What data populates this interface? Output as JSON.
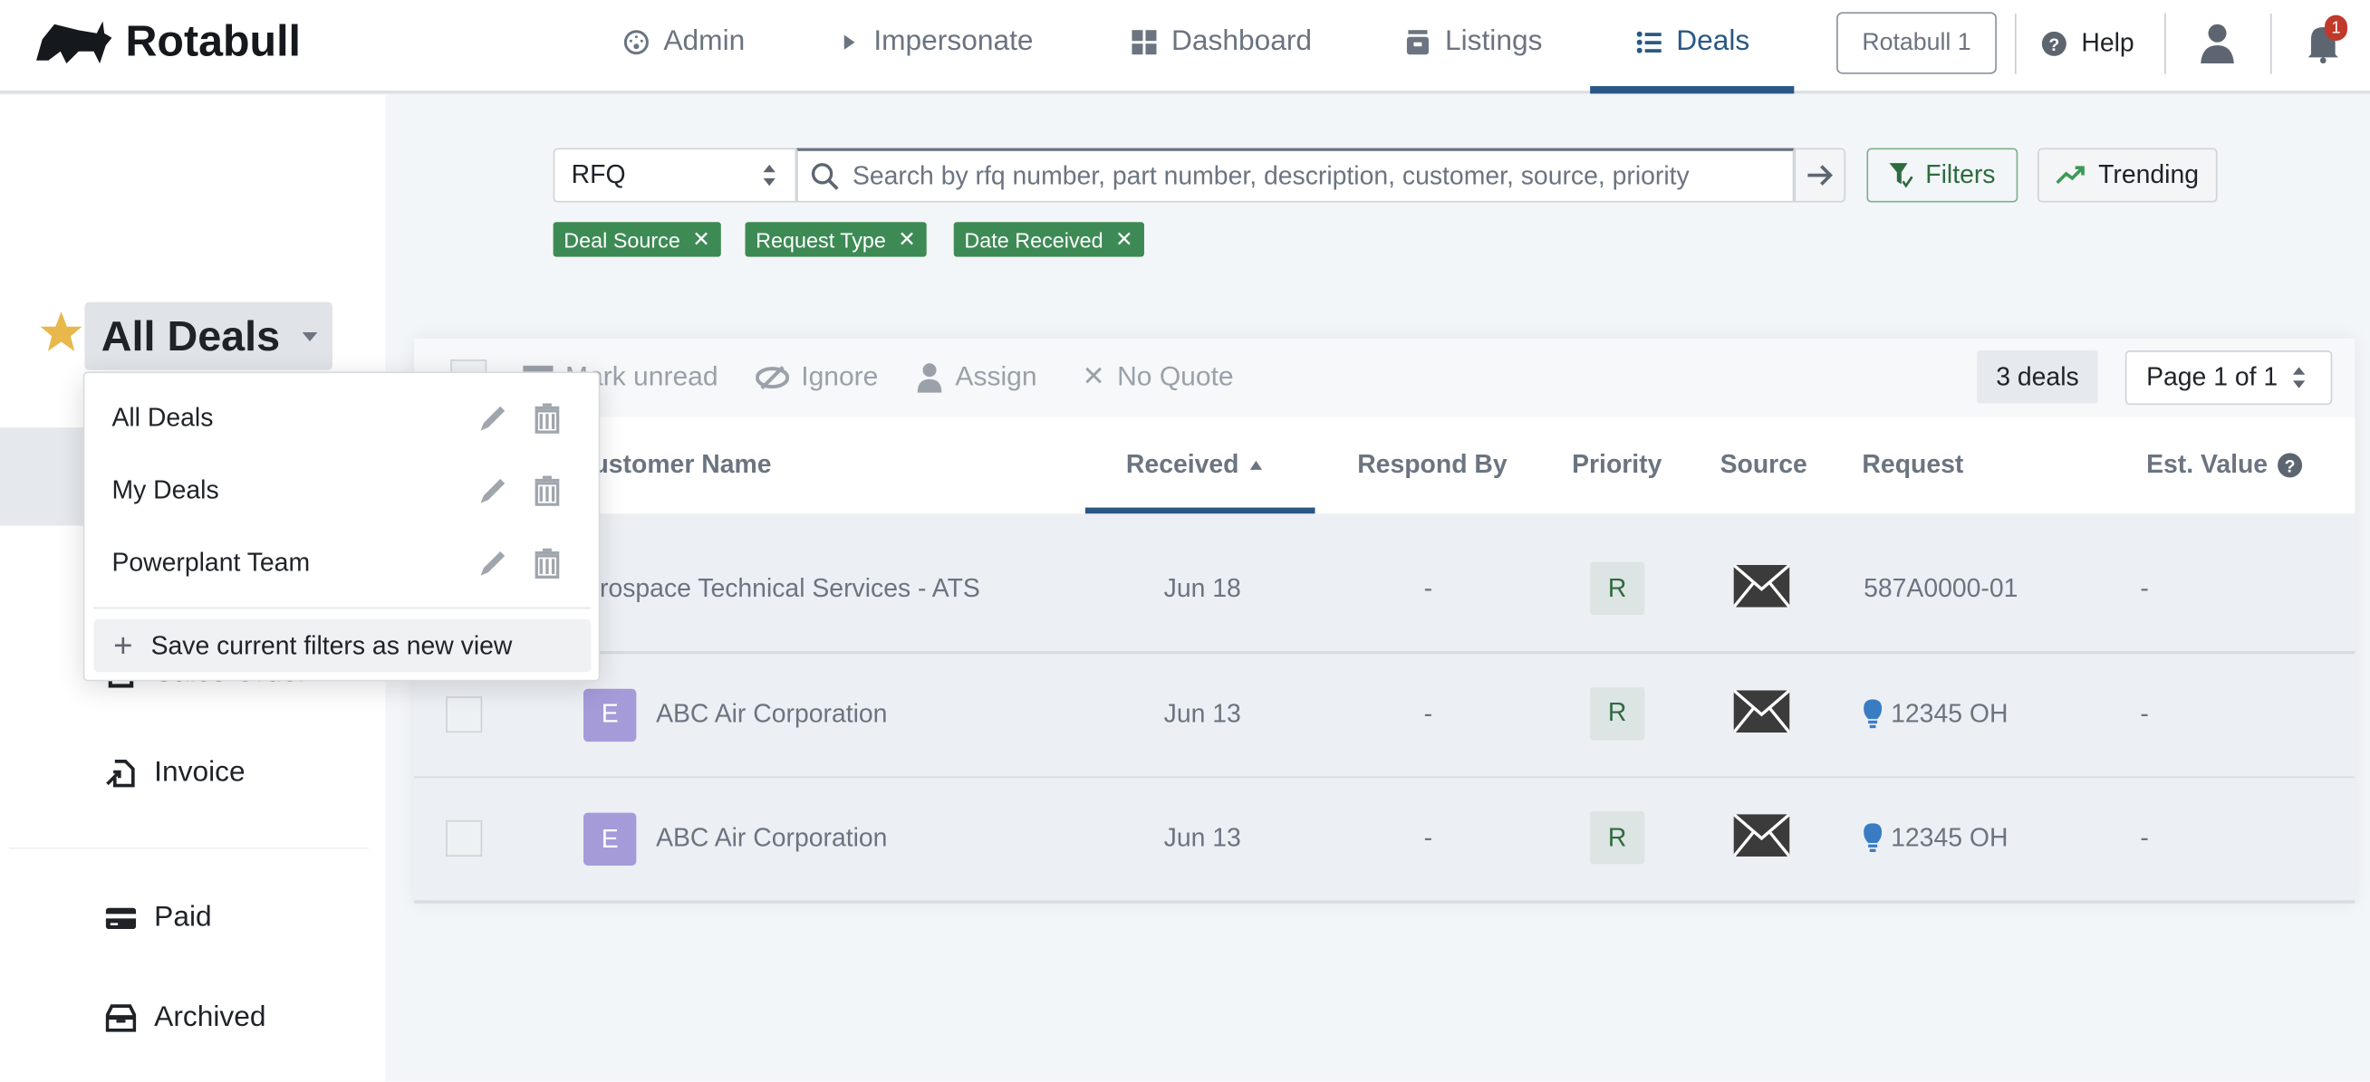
{
  "app": {
    "name": "Rotabull"
  },
  "nav": {
    "items": [
      {
        "label": "Admin",
        "icon": "dashboard-gauge-icon"
      },
      {
        "label": "Impersonate",
        "icon": "play-icon"
      },
      {
        "label": "Dashboard",
        "icon": "grid-icon"
      },
      {
        "label": "Listings",
        "icon": "archive-icon"
      },
      {
        "label": "Deals",
        "icon": "list-icon",
        "active": true
      }
    ],
    "account": "Rotabull 1",
    "help": "Help",
    "notifications_count": "1"
  },
  "colors": {
    "accent": "#2a5886",
    "chip": "#3d8a55",
    "avatar": "#a59bd9",
    "badge": "#c0392b",
    "star": "#e8b84a"
  },
  "view": {
    "title": "All Deals",
    "dropdown": {
      "items": [
        {
          "label": "All Deals"
        },
        {
          "label": "My Deals"
        },
        {
          "label": "Powerplant Team"
        }
      ],
      "save_label": "Save current filters as new view"
    }
  },
  "sidebar": {
    "items": [
      {
        "label": "Sales Order",
        "icon": "document-icon"
      },
      {
        "label": "Invoice",
        "icon": "file-import-icon"
      },
      {
        "label": "Paid",
        "icon": "credit-card-icon"
      },
      {
        "label": "Archived",
        "icon": "archive-box-icon"
      }
    ]
  },
  "search": {
    "type": "RFQ",
    "placeholder": "Search by rfq number, part number, description, customer, source, priority",
    "value": ""
  },
  "buttons": {
    "filters": "Filters",
    "trending": "Trending"
  },
  "chips": [
    "Deal Source",
    "Request Type",
    "Date Received"
  ],
  "toolbar": {
    "mark_unread": "Mark unread",
    "ignore": "Ignore",
    "assign": "Assign",
    "no_quote": "No Quote",
    "count": "3 deals",
    "page": "Page 1 of 1"
  },
  "table": {
    "columns": [
      "Customer Name",
      "Received",
      "Respond By",
      "Priority",
      "Source",
      "Request",
      "Est. Value"
    ],
    "sorted_by": "Received",
    "sort_dir": "asc",
    "rows": [
      {
        "avatar": "",
        "customer": "Aerospace Technical Services - ATS",
        "received": "Jun 18",
        "respond_by": "-",
        "priority": "R",
        "source": "email",
        "request": "587A0000-01",
        "request_icon": "",
        "est_value": "-"
      },
      {
        "avatar": "E",
        "customer": "ABC Air Corporation",
        "received": "Jun 13",
        "respond_by": "-",
        "priority": "R",
        "source": "email",
        "request": "12345 OH",
        "request_icon": "lightbulb-icon",
        "est_value": "-"
      },
      {
        "avatar": "E",
        "customer": "ABC Air Corporation",
        "received": "Jun 13",
        "respond_by": "-",
        "priority": "R",
        "source": "email",
        "request": "12345 OH",
        "request_icon": "lightbulb-icon",
        "est_value": "-"
      }
    ]
  }
}
